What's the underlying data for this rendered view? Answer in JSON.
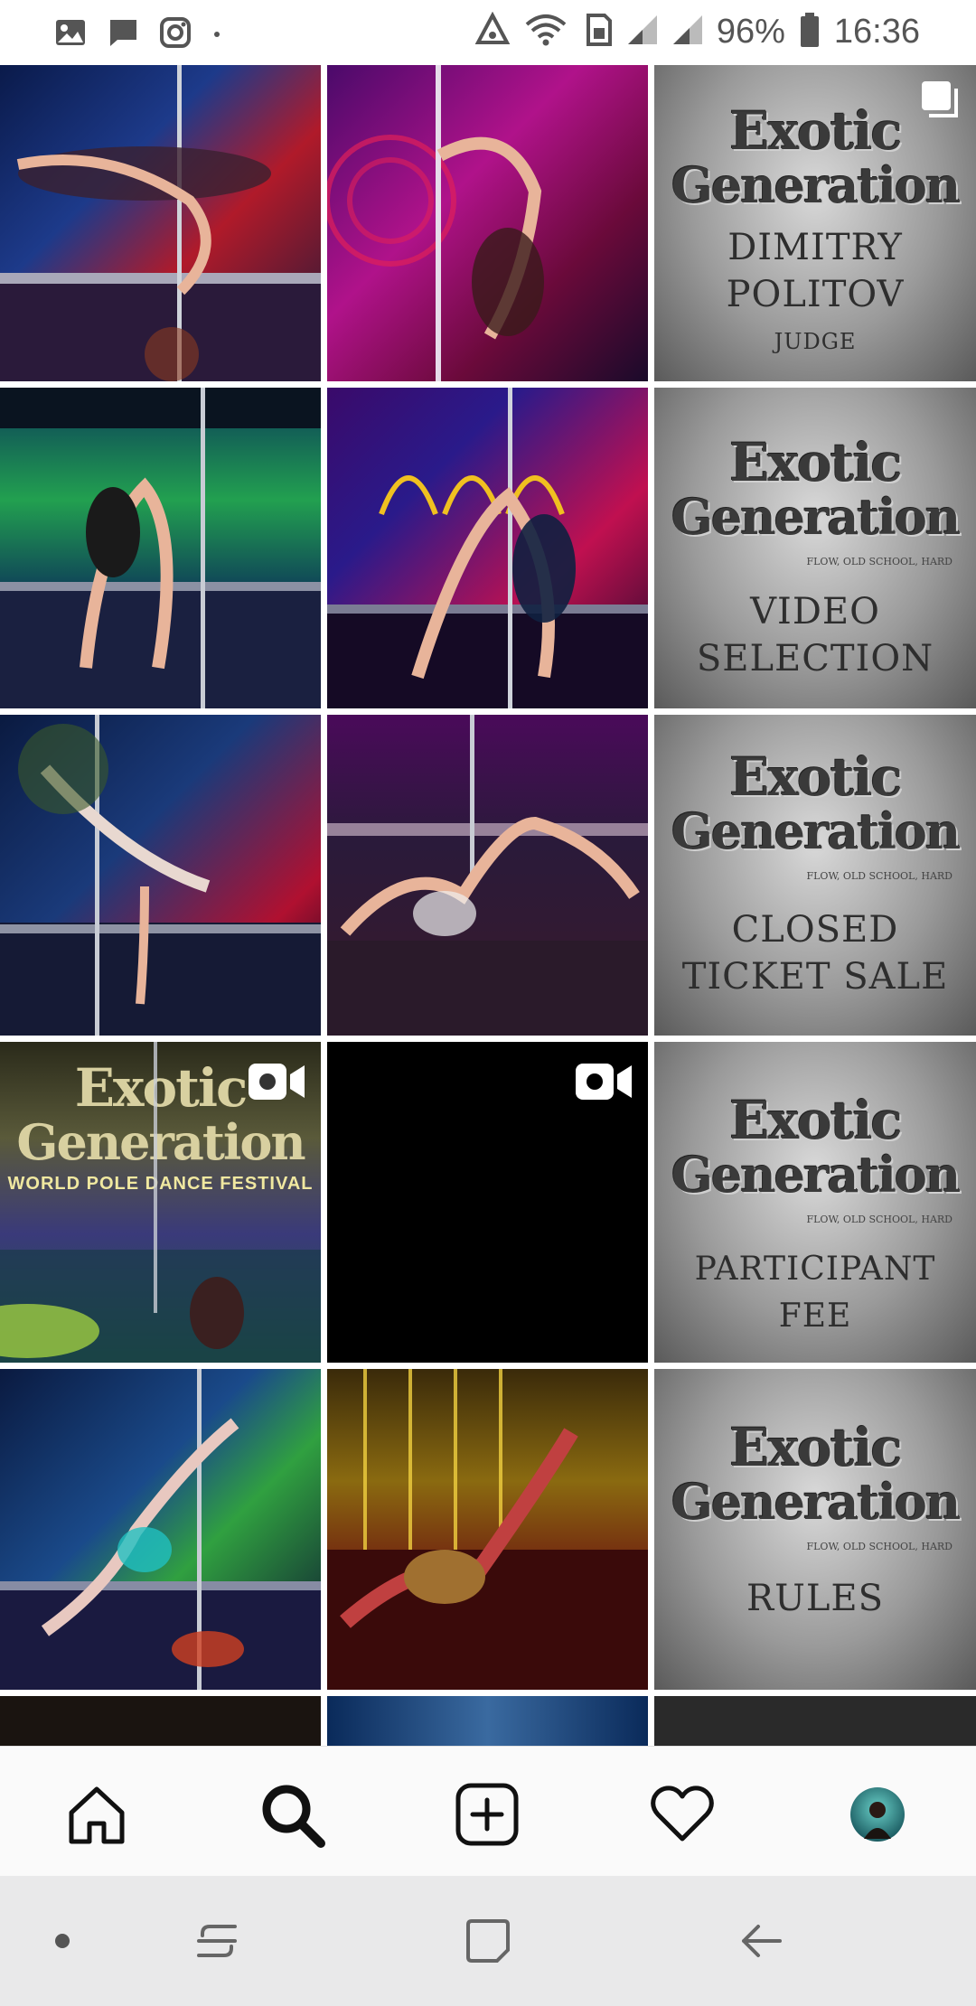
{
  "status_bar": {
    "left_icons": [
      "gallery-icon",
      "message-icon",
      "instagram-icon",
      "dot-icon"
    ],
    "right_icons": [
      "data-saver-icon",
      "wifi-icon",
      "sim-icon",
      "signal-icon",
      "signal-icon"
    ],
    "battery_percent": "96%",
    "time": "16:36"
  },
  "grid": {
    "posts": [
      {
        "type": "photo",
        "theme": "pole-dancer-red-blue"
      },
      {
        "type": "photo",
        "theme": "pole-dancer-magenta"
      },
      {
        "type": "card",
        "multi": true,
        "logo_line1": "Exotic",
        "logo_line2": "Generation",
        "caption_lines": [
          "DIMITRY",
          "POLITOV",
          "JUDGE"
        ]
      },
      {
        "type": "photo",
        "theme": "dancer-green-screen"
      },
      {
        "type": "photo",
        "theme": "dancer-pink-neon"
      },
      {
        "type": "card",
        "logo_line1": "Exotic",
        "logo_line2": "Generation",
        "tagline": "FLOW, OLD SCHOOL, HARD",
        "caption_lines": [
          "VIDEO",
          "SELECTION"
        ]
      },
      {
        "type": "photo",
        "theme": "dancer-blue-trees"
      },
      {
        "type": "photo",
        "theme": "dancer-purple-floor"
      },
      {
        "type": "card",
        "logo_line1": "Exotic",
        "logo_line2": "Generation",
        "tagline": "FLOW, OLD SCHOOL, HARD",
        "caption_lines": [
          "CLOSED",
          "TICKET SALE"
        ]
      },
      {
        "type": "video",
        "theme": "festival-video",
        "logo_line1": "Exotic",
        "logo_line2": "Generation",
        "banner": "WORLD POLE DANCE FESTIVAL"
      },
      {
        "type": "video",
        "theme": "black"
      },
      {
        "type": "card",
        "logo_line1": "Exotic",
        "logo_line2": "Generation",
        "tagline": "FLOW, OLD SCHOOL, HARD",
        "caption_lines": [
          "PARTICIPANT",
          "FEE"
        ]
      },
      {
        "type": "photo",
        "theme": "dancer-blue-green"
      },
      {
        "type": "photo",
        "theme": "dancer-red-gold"
      },
      {
        "type": "card",
        "logo_line1": "Exotic",
        "logo_line2": "Generation",
        "tagline": "FLOW, OLD SCHOOL, HARD",
        "caption_lines": [
          "RULES"
        ]
      }
    ]
  },
  "bottom_nav": {
    "items": [
      "home-icon",
      "search-icon",
      "new-post-icon",
      "activity-heart-icon",
      "profile-avatar"
    ]
  },
  "system_nav": {
    "items": [
      "dot-icon",
      "recents-icon",
      "home-square-icon",
      "back-icon"
    ]
  },
  "colors": {
    "accent_black": "#000000",
    "nav_bg": "#fafafa",
    "sys_nav_bg": "#e9e9ea"
  }
}
